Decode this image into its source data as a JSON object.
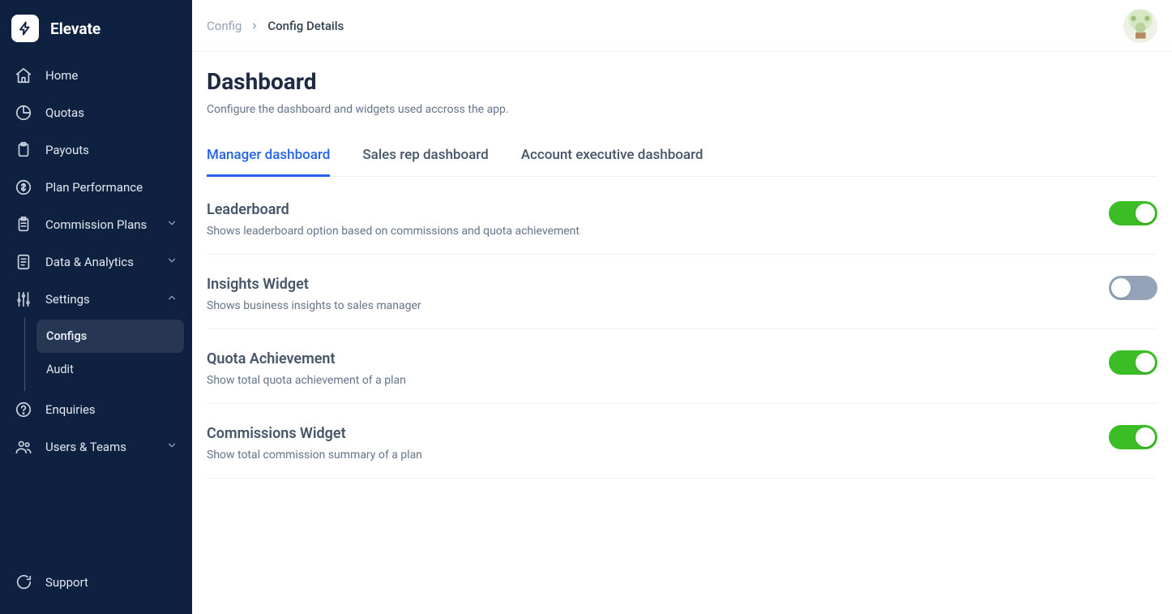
{
  "brand": {
    "name": "Elevate"
  },
  "sidebar": {
    "items": [
      {
        "label": "Home"
      },
      {
        "label": "Quotas"
      },
      {
        "label": "Payouts"
      },
      {
        "label": "Plan Performance"
      },
      {
        "label": "Commission Plans",
        "expandable": true
      },
      {
        "label": "Data & Analytics",
        "expandable": true
      },
      {
        "label": "Settings",
        "expandable": true,
        "expanded": true,
        "children": [
          {
            "label": "Configs",
            "active": true
          },
          {
            "label": "Audit"
          }
        ]
      },
      {
        "label": "Enquiries"
      },
      {
        "label": "Users & Teams",
        "expandable": true
      }
    ],
    "footer": {
      "support": "Support"
    }
  },
  "breadcrumb": {
    "root": "Config",
    "current": "Config Details"
  },
  "page": {
    "title": "Dashboard",
    "subtitle": "Configure the dashboard and widgets used accross the app."
  },
  "tabs": [
    {
      "label": "Manager dashboard",
      "active": true
    },
    {
      "label": "Sales rep dashboard"
    },
    {
      "label": "Account executive dashboard"
    }
  ],
  "settings": [
    {
      "title": "Leaderboard",
      "desc": "Shows leaderboard option based on commissions and quota achievement",
      "on": true
    },
    {
      "title": "Insights Widget",
      "desc": "Shows business insights to sales manager",
      "on": false
    },
    {
      "title": "Quota Achievement",
      "desc": "Show total quota achievement of a plan",
      "on": true
    },
    {
      "title": "Commissions Widget",
      "desc": "Show total commission summary of a plan",
      "on": true
    }
  ]
}
